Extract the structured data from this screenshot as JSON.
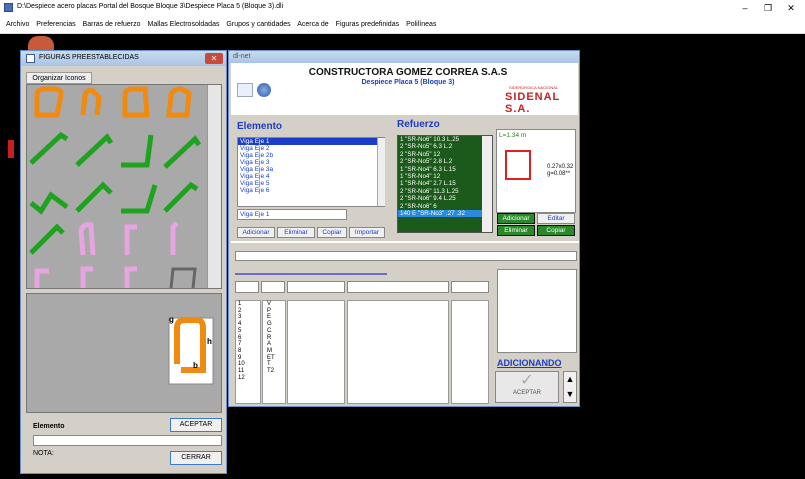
{
  "window": {
    "title": "D:\\Despiece acero placas Portal del Bosque Bloque 3\\Despiece Placa 5 (Bloque 3).dli",
    "controls": {
      "minimize": "–",
      "maximize": "❐",
      "close": "✕"
    }
  },
  "menu": [
    "Archivo",
    "Preferencias",
    "Barras de refuerzo",
    "Mallas Electrosoldadas",
    "Grupos y cantidades",
    "Acerca de",
    "Figuras predefinidas",
    "Polilíneas"
  ],
  "figuras": {
    "title": "FIGURAS PREESTABLECIDAS",
    "tab_label": "Organizar Iconos",
    "shape_labels": {
      "g": "g",
      "h": "h",
      "b": "b"
    },
    "elemento_label": "Elemento",
    "aceptar_label": "ACEPTAR",
    "nota_label": "NOTA:",
    "cerrar_label": "CERRAR",
    "icon_rows": [
      [
        "hook-orange",
        "hook-orange",
        "hook-orange",
        "hook-orange"
      ],
      [
        "bar-green",
        "bar-green",
        "bar-green",
        "bar-green"
      ],
      [
        "bar-green",
        "bar-green",
        "bar-green",
        "bar-green"
      ],
      [
        "bar-green",
        "stirrup-pink",
        "stirrup-pink",
        "stirrup-pink"
      ],
      [
        "stirrup-pink",
        "stirrup-pink",
        "stirrup-pink",
        "stirrup-gray"
      ]
    ]
  },
  "dlnet": {
    "title": "dl-net",
    "company": "CONSTRUCTORA GOMEZ CORREA S.A.S",
    "subtitle": "Despiece Placa 5 (Bloque 3)",
    "brand": "SIDENAL S.A.",
    "brand_sub": "SIDERÚRGICA NACIONAL",
    "elemento_heading": "Elemento",
    "refuerzo_heading": "Refuerzo",
    "elementos": [
      "Viga Eje 1",
      "Viga Eje 2",
      "Viga Eje 2b",
      "Viga Eje 3",
      "Viga Eje 3a",
      "Viga Eje 4",
      "Viga Eje 5",
      "Viga Eje 6"
    ],
    "elemento_input": "Viga Eje 1",
    "elemento_buttons": {
      "adicionar": "Adicionar",
      "eliminar": "Eliminar",
      "copiar": "Copiar",
      "importar": "Importar"
    },
    "refuerzos": [
      "1  \"SR-No6\"  10.3  L.25",
      "2  \"SR-No5\"  6.3  L.2",
      "2  \"SR-No5\"  12",
      "2  \"SR-No5\"  2.8  L.2",
      "1  \"SR-No4\"  6.3  L.15",
      "1  \"SR-No4\"  12",
      "1  \"SR-No4\"  2.7  L.15",
      "2  \"SR-No6\"  11.3  L.25",
      "2  \"SR-No6\"  9.4  L.25",
      "2  \"SR-No6\"  6",
      "140  E  \"SR-No3\"  .27 .32"
    ],
    "preview": {
      "length": "L=1.34 m",
      "dims": "0.27x0.32",
      "g": "g=0.08**"
    },
    "refuerzo_buttons": {
      "adicionar": "Adicionar",
      "editar": "Editar",
      "eliminar": "Eliminar",
      "copiar": "Copiar"
    },
    "row_numbers": [
      "1",
      "2",
      "3",
      "4",
      "5",
      "6",
      "7",
      "8",
      "9",
      "10",
      "11",
      "12"
    ],
    "row_letters": [
      "",
      "",
      "V",
      "P",
      "E",
      "G",
      "C",
      "R",
      "A",
      "M",
      "ET",
      "T",
      "T2"
    ],
    "status": "ADICIONANDO",
    "aceptar_label": "ACEPTAR"
  },
  "colors": {
    "accent_blue": "#1a3ec8",
    "ref_bg": "#1c5a1c",
    "brand_red": "#c82020"
  }
}
